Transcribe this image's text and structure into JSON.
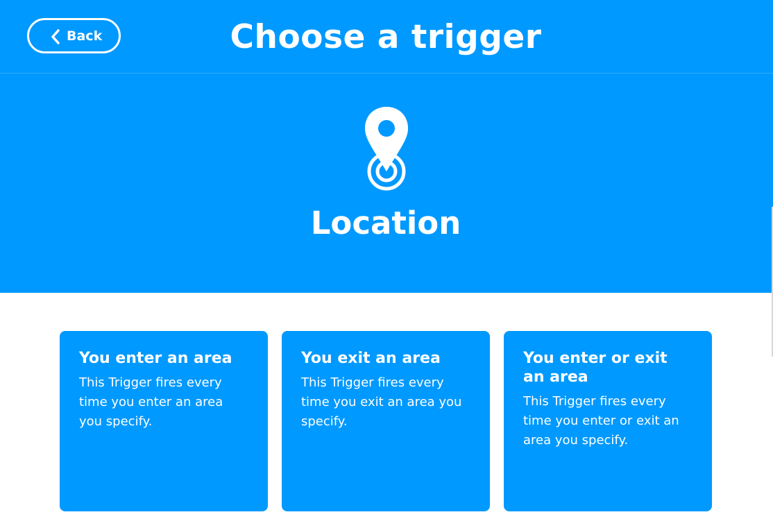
{
  "header": {
    "back_label": "Back",
    "title": "Choose a trigger"
  },
  "hero": {
    "icon": "location-pin-icon",
    "service_name": "Location"
  },
  "colors": {
    "brand_blue": "#0099ff",
    "text": "#ffffff"
  },
  "triggers": [
    {
      "title": "You enter an area",
      "description": "This Trigger fires every time you enter an area you specify."
    },
    {
      "title": "You exit an area",
      "description": "This Trigger fires every time you exit an area you specify."
    },
    {
      "title": "You enter or exit an area",
      "description": "This Trigger fires every time you enter or exit an area you specify."
    }
  ]
}
